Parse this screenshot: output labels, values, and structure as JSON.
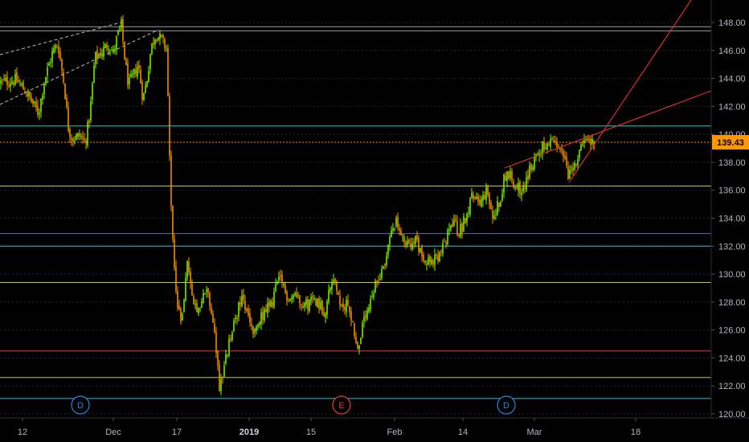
{
  "chart_data": {
    "type": "candlestick",
    "y_axis": {
      "ticks": [
        "148.00",
        "146.00",
        "144.00",
        "142.00",
        "140.00",
        "138.00",
        "136.00",
        "134.00",
        "132.00",
        "130.00",
        "128.00",
        "126.00",
        "124.00",
        "122.00",
        "120.00"
      ],
      "range": [
        119.5,
        149.5
      ]
    },
    "x_axis": {
      "ticks": [
        {
          "label": "12",
          "bold": false
        },
        {
          "label": "Dec",
          "bold": false
        },
        {
          "label": "17",
          "bold": false
        },
        {
          "label": "2019",
          "bold": true
        },
        {
          "label": "15",
          "bold": false
        },
        {
          "label": "Feb",
          "bold": false
        },
        {
          "label": "14",
          "bold": false
        },
        {
          "label": "Mar",
          "bold": false
        },
        {
          "label": "18",
          "bold": false
        }
      ]
    },
    "last_price": {
      "label": "139.43",
      "value": 139.43,
      "color": "#ff9800"
    },
    "horizontal_levels": [
      {
        "value": 147.7,
        "color": "#9e9e9e"
      },
      {
        "value": 147.4,
        "color": "#9e9e9e"
      },
      {
        "value": 140.6,
        "color": "#26c6da"
      },
      {
        "value": 139.43,
        "color": "#ff9800"
      },
      {
        "value": 136.3,
        "color": "#c0ca33"
      },
      {
        "value": 132.9,
        "color": "#5c6bc0"
      },
      {
        "value": 132.0,
        "color": "#26c6da"
      },
      {
        "value": 129.4,
        "color": "#c0ca33"
      },
      {
        "value": 124.5,
        "color": "#e53935"
      },
      {
        "value": 122.6,
        "color": "#c0ca33"
      },
      {
        "value": 121.1,
        "color": "#26c6da"
      }
    ],
    "event_badges": [
      {
        "label": "D",
        "color": "#1e88e5"
      },
      {
        "label": "E",
        "color": "#e53935"
      },
      {
        "label": "D",
        "color": "#1e88e5"
      }
    ],
    "series_colors": {
      "up": "#7cfc00",
      "down": "#ff9800"
    },
    "trendline_color": "#d32f2f",
    "dashed_color": "#bdbdbd",
    "grid": true,
    "legend": "none"
  }
}
